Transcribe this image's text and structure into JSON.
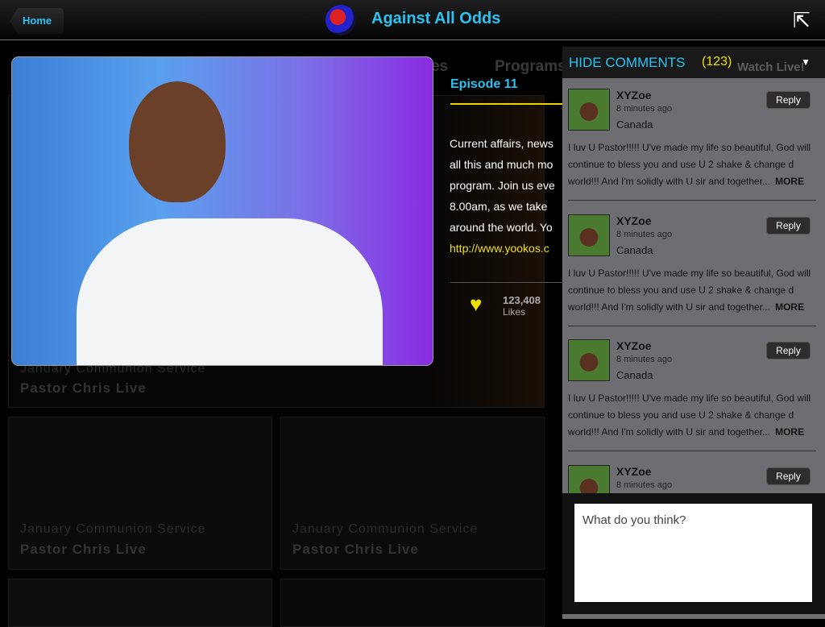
{
  "header": {
    "home_label": "Home",
    "title": "Against All Odds"
  },
  "background": {
    "nav": [
      "es",
      "Programs",
      "Watch Live!"
    ],
    "tiles": [
      {
        "title": "January Communion Service",
        "subtitle": "Pastor Chris Live"
      },
      {
        "title": "January Communion Service",
        "subtitle": "Pastor Chris Live"
      },
      {
        "title": "January Communion Service",
        "subtitle": "Pastor Chris Live"
      }
    ]
  },
  "episode": {
    "title": "Episode 11",
    "lines": [
      "Current affairs, news",
      "all this and much mo",
      "program. Join us eve",
      "8.00am, as we take",
      "around the world. Yo"
    ],
    "link": "http://www.yookos.c",
    "likes_count": "123,408",
    "likes_label": "Likes"
  },
  "comments": {
    "toggle_label": "HIDE COMMENTS",
    "count": "(123)",
    "reply_label": "Reply",
    "more_label": "MORE",
    "items": [
      {
        "name": "XYZoe",
        "time": "8 minutes ago",
        "location": "Canada",
        "text": "I luv U Pastor!!!!! U've made my life so beautiful, God will continue to bless you and use U 2 shake & change d world!!! And I'm solidly with U sir and together..."
      },
      {
        "name": "XYZoe",
        "time": "8 minutes ago",
        "location": "Canada",
        "text": "I luv U Pastor!!!!! U've made my life so beautiful, God will continue to bless you and use U 2 shake & change d world!!! And I'm solidly with U sir and together..."
      },
      {
        "name": "XYZoe",
        "time": "8 minutes ago",
        "location": "Canada",
        "text": "I luv U Pastor!!!!! U've made my life so beautiful, God will continue to bless you and use U 2 shake & change d world!!! And I'm solidly with U sir and together..."
      },
      {
        "name": "XYZoe",
        "time": "8 minutes ago",
        "location": "",
        "text": ""
      }
    ],
    "input_placeholder": "What do you think?"
  },
  "colors": {
    "accent": "#2bc3f2",
    "highlight": "#f0e000",
    "panel": "#6e6d72"
  }
}
